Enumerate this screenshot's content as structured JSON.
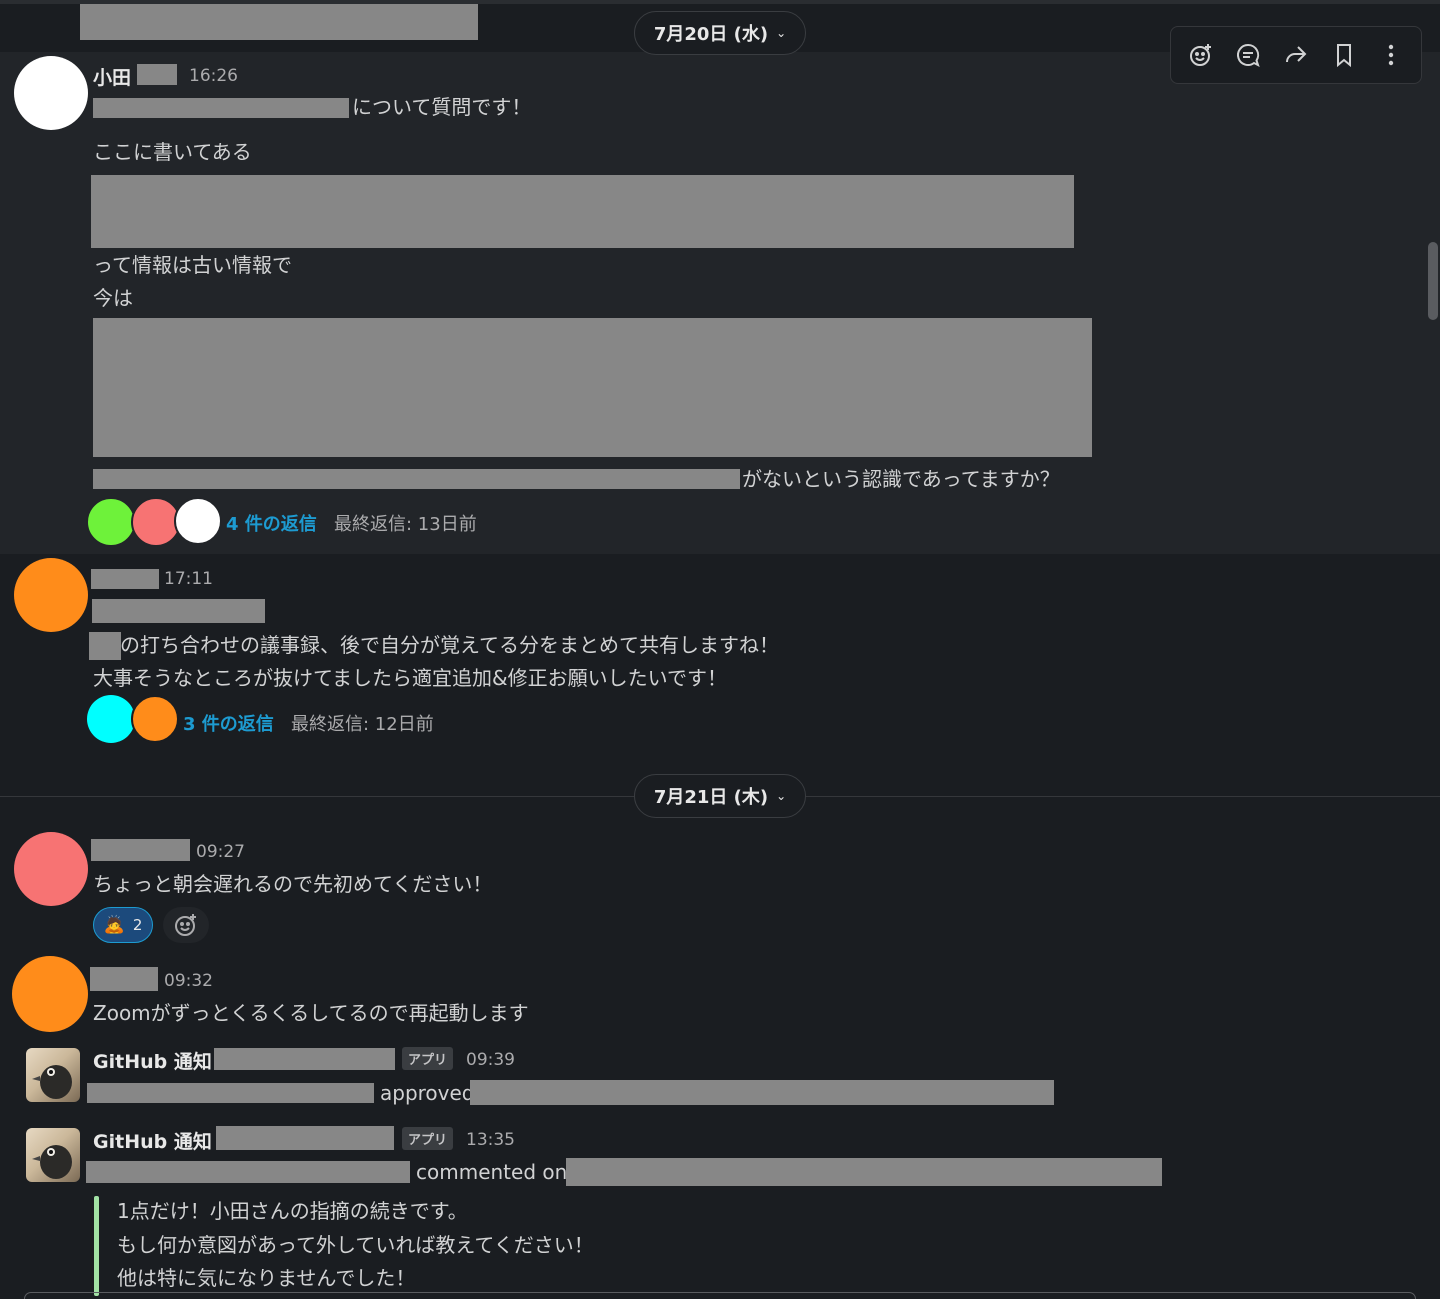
{
  "date_dividers": {
    "first": "7月20日 (水)",
    "second": "7月21日 (木)"
  },
  "colors": {
    "background": "#1a1d21",
    "highlight": "#222529",
    "link": "#1d9bd1",
    "quote_bar": "#a2e2a5",
    "avatar_white": "#ffffff",
    "avatar_orange": "#ff8c1a",
    "avatar_pink": "#f77373",
    "avatar_green": "#6ef23a",
    "avatar_cyan": "#00ffff"
  },
  "toolbar": {
    "icons": [
      "add-reaction-icon",
      "reply-thread-icon",
      "share-forward-icon",
      "bookmark-icon",
      "more-actions-icon"
    ]
  },
  "messages": {
    "m1": {
      "name": "小田",
      "time": "16:26",
      "line1": "について質問です！",
      "line2": "ここに書いてある",
      "line3": "って情報は古い情報で",
      "line4": "今は",
      "line5": "がないという認識であってますか？",
      "reply_count": "4 件の返信",
      "last_reply": "最終返信: 13日前"
    },
    "m2": {
      "time": "17:11",
      "line1": "の打ち合わせの議事録、後で自分が覚えてる分をまとめて共有しますね！",
      "line2": "大事そうなところが抜けてましたら適宜追加&修正お願いしたいです！",
      "reply_count": "3 件の返信",
      "last_reply": "最終返信: 12日前"
    },
    "m3": {
      "time": "09:27",
      "line1": "ちょっと朝会遅れるので先初めてください！",
      "reaction_count": "2",
      "reaction_emoji": "🙇"
    },
    "m4": {
      "time": "09:32",
      "line1": "Zoomがずっとくるくるしてるので再起動します"
    },
    "m5": {
      "name": "GitHub 通知",
      "badge": "アプリ",
      "time": "09:39",
      "action": "approved"
    },
    "m6": {
      "name": "GitHub 通知",
      "badge": "アプリ",
      "time": "13:35",
      "action": "commented on",
      "quote1": "1点だけ！小田さんの指摘の続きです。",
      "quote2": "もし何か意図があって外していれば教えてください！",
      "quote3": "他は特に気になりませんでした！"
    }
  }
}
